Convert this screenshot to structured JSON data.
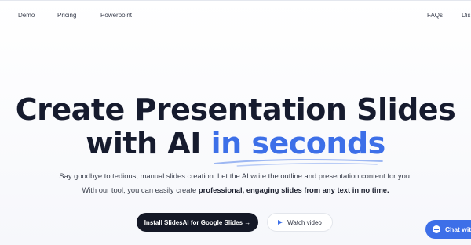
{
  "nav": {
    "links": [
      "Demo",
      "Pricing",
      "Powerpoint",
      "FAQs",
      "Dis"
    ]
  },
  "hero": {
    "line1": "Create Presentation Slides",
    "line2_prefix": "with AI ",
    "line2_accent": "in seconds",
    "accent_color": "#3d6fe8"
  },
  "subtitle": {
    "line1": "Say goodbye to tedious, manual slides creation. Let the AI write the outline and presentation content for you.",
    "line2_prefix": "With our tool, you can easily create ",
    "line2_bold": "professional, engaging slides from any text in no time."
  },
  "cta": {
    "primary_label": "Install SlidesAI for Google Slides →",
    "secondary_label": "Watch video",
    "secondary_icon": "play-icon"
  },
  "chat": {
    "label": "Chat with",
    "icon": "chat-bubble-icon",
    "color": "#3d6fe8"
  }
}
